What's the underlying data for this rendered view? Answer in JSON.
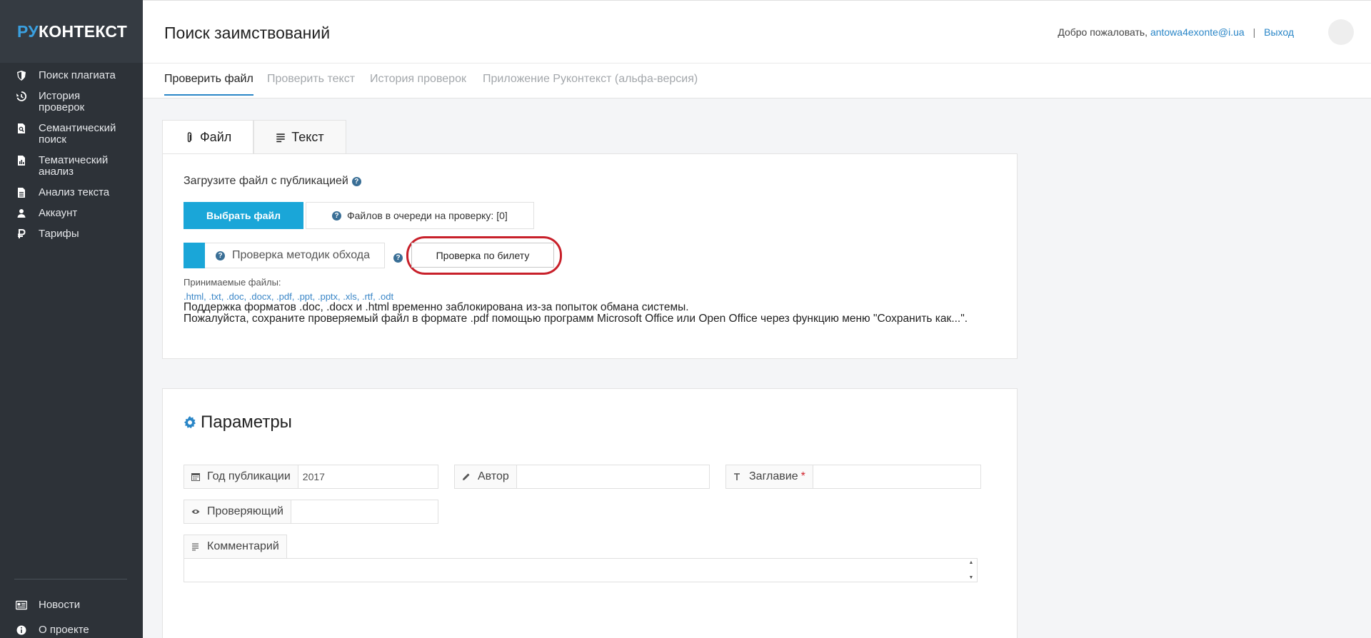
{
  "logo": {
    "part1": "РУ",
    "part2": "КОНТЕКСТ"
  },
  "sidebar": {
    "items": [
      {
        "label": "Поиск плагиата",
        "icon": "shield-icon"
      },
      {
        "label": "История проверок",
        "icon": "history-icon"
      },
      {
        "label": "Семантический поиск",
        "icon": "document-search-icon"
      },
      {
        "label": "Тематический анализ",
        "icon": "chart-document-icon"
      },
      {
        "label": "Анализ текста",
        "icon": "document-icon"
      },
      {
        "label": "Аккаунт",
        "icon": "user-icon"
      },
      {
        "label": "Тарифы",
        "icon": "ruble-icon"
      }
    ],
    "bottom_items": [
      {
        "label": "Новости",
        "icon": "newspaper-icon"
      },
      {
        "label": "О проекте",
        "icon": "info-icon"
      }
    ]
  },
  "header": {
    "title": "Поиск заимствований",
    "welcome": "Добро пожаловать,",
    "email": "antowa4exonte@i.ua",
    "separator": "|",
    "logout": "Выход"
  },
  "tabs": [
    {
      "label": "Проверить файл",
      "active": true
    },
    {
      "label": "Проверить текст",
      "active": false
    },
    {
      "label": "История проверок",
      "active": false
    },
    {
      "label": "Приложение Руконтекст (альфа-версия)",
      "active": false
    }
  ],
  "card_tabs": [
    {
      "label": "Файл",
      "icon": "paperclip-icon"
    },
    {
      "label": "Текст",
      "icon": "text-lines-icon"
    }
  ],
  "upload": {
    "label": "Загрузите файл с публикацией",
    "help": "?",
    "choose_button": "Выбрать файл",
    "queue_text": "Файлов в очереди на проверку: [0]",
    "bypass_label": "Проверка методик обхода",
    "ticket_button": "Проверка по билету",
    "accepted_title": "Принимаемые файлы:",
    "accepted_list": ".html, .txt, .doc, .docx, .pdf, .ppt, .pptx, .xls, .rtf, .odt",
    "notice_line1": "Поддержка форматов .doc, .docx и .html временно заблокирована из-за попыток обмана системы.",
    "notice_line2": "Пожалуйста, сохраните проверяемый файл в формате .pdf помощью программ Microsoft Office или Open Office через функцию меню \"Сохранить как...\"."
  },
  "params": {
    "title": "Параметры",
    "year_label": "Год публикации",
    "year_value": "2017",
    "author_label": "Автор",
    "author_value": "",
    "title_label": "Заглавие",
    "required_mark": "*",
    "title_value": "",
    "checker_label": "Проверяющий",
    "checker_value": "",
    "comment_label": "Комментарий",
    "comment_value": ""
  },
  "colors": {
    "sidebar_bg": "#2d3238",
    "accent": "#1aa6d8",
    "link": "#2a86c7",
    "highlight": "#c8202a"
  }
}
